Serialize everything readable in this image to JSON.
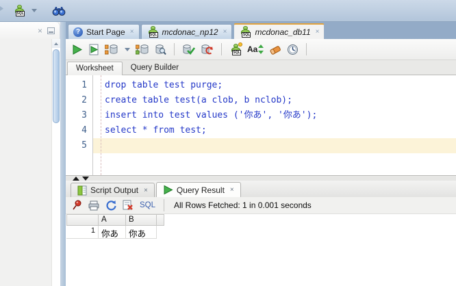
{
  "ui": {
    "close_glyph": "×",
    "sql_badge": "SQL",
    "help_glyph": "?",
    "case_icon_text": "Aa"
  },
  "top_tabs": [
    {
      "label": "Start Page"
    },
    {
      "label": "mcdonac_np12"
    },
    {
      "label": "mcdonac_db11"
    }
  ],
  "worksheet_tabs": [
    {
      "label": "Worksheet"
    },
    {
      "label": "Query Builder"
    }
  ],
  "editor": {
    "lines": [
      {
        "num": "1",
        "code": "drop table test purge;"
      },
      {
        "num": "2",
        "code": "create table test(a clob, b nclob);"
      },
      {
        "num": "3",
        "code": "insert into test values ('你あ', '你あ');"
      },
      {
        "num": "4",
        "code": "select * from test;"
      },
      {
        "num": "5",
        "code": ""
      }
    ]
  },
  "bottom_tabs": [
    {
      "label": "Script Output"
    },
    {
      "label": "Query Result"
    }
  ],
  "result_toolbar": {
    "sql_link": "SQL",
    "status": "All Rows Fetched: 1 in 0.001 seconds"
  },
  "grid": {
    "columns": [
      "A",
      "B"
    ],
    "rows": [
      {
        "num": "1",
        "cells": [
          "你あ",
          "你あ"
        ]
      }
    ]
  },
  "colors": {
    "active_tab_accent": "#e2a33e",
    "code_text": "#2438c8",
    "current_line_bg": "#fcf3d8",
    "tab_strip_bg": "#93abc7"
  }
}
